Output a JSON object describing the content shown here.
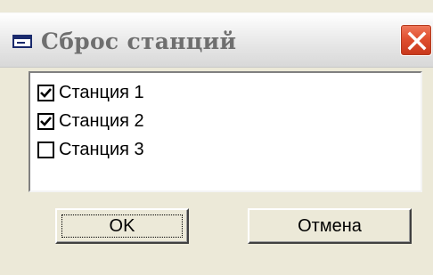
{
  "window": {
    "title": "Сброс станций",
    "icon": "window-app-icon",
    "close_icon": "close-icon",
    "accent_close": "#e0502f"
  },
  "stations": [
    {
      "label": "Станция 1",
      "checked": true
    },
    {
      "label": "Станция 2",
      "checked": true
    },
    {
      "label": "Станция 3",
      "checked": false
    }
  ],
  "buttons": {
    "ok_label": "OK",
    "cancel_label": "Отмена"
  }
}
